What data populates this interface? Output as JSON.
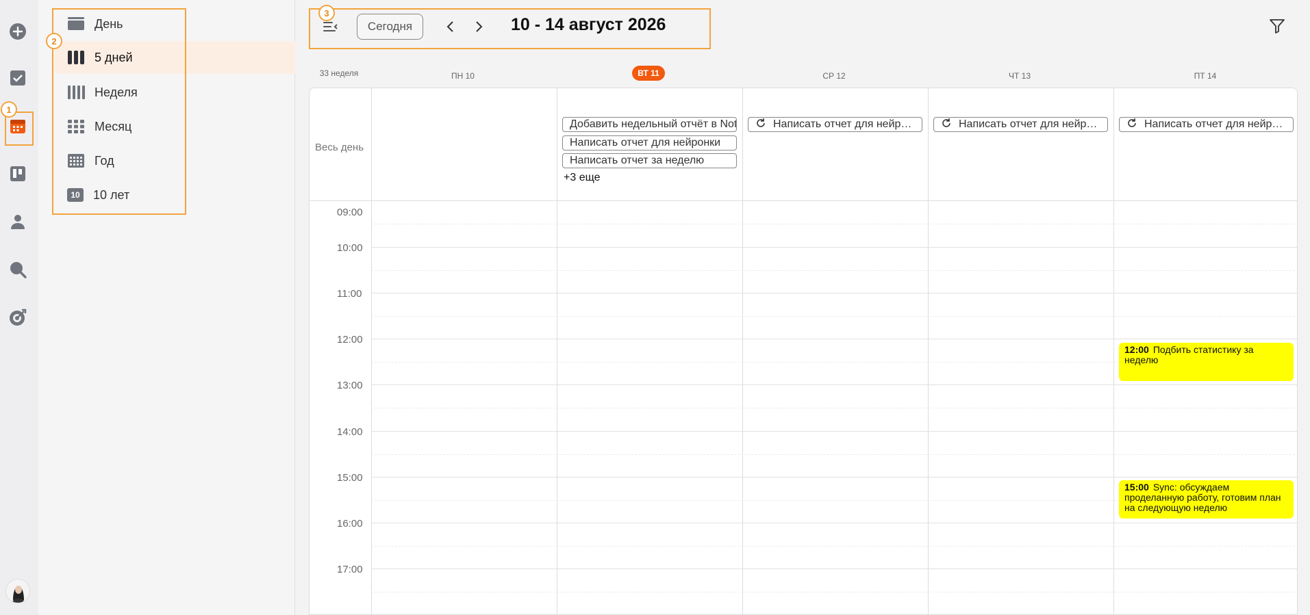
{
  "colors": {
    "accent": "#F25A0F",
    "annotation": "#F3A33C",
    "event_yellow": "#FFFF00"
  },
  "rail": {
    "items": [
      {
        "name": "plus-circle-icon"
      },
      {
        "name": "checkbox-icon"
      },
      {
        "name": "calendar-icon"
      },
      {
        "name": "kanban-icon"
      },
      {
        "name": "user-icon"
      },
      {
        "name": "search-icon"
      },
      {
        "name": "target-icon"
      }
    ],
    "badge": "1"
  },
  "views": {
    "badge": "2",
    "items": [
      {
        "label": "День",
        "icon": "day-view-icon"
      },
      {
        "label": "5 дней",
        "icon": "five-day-view-icon",
        "active": true
      },
      {
        "label": "Неделя",
        "icon": "week-view-icon"
      },
      {
        "label": "Месяц",
        "icon": "month-view-icon"
      },
      {
        "label": "Год",
        "icon": "year-view-icon"
      },
      {
        "label": "10 лет",
        "icon": "decade-view-icon",
        "icon_text": "10"
      }
    ]
  },
  "toolbar": {
    "badge": "3",
    "today_label": "Сегодня",
    "range_title": "10 - 14 август 2026"
  },
  "calendar": {
    "week_label": "33 неделя",
    "days": [
      {
        "label": "ПН 10"
      },
      {
        "label": "ВТ 11",
        "today": true
      },
      {
        "label": "СР 12"
      },
      {
        "label": "ЧТ 13"
      },
      {
        "label": "ПТ 14"
      }
    ],
    "allday_label": "Весь день",
    "allday_events": [
      {
        "day": 1,
        "row": 0,
        "title": "Добавить недельный отчёт в Notion"
      },
      {
        "day": 1,
        "row": 1,
        "title": "Написать отчет для нейронки"
      },
      {
        "day": 1,
        "row": 2,
        "title": "Написать отчет за неделю"
      },
      {
        "day": 2,
        "row": 0,
        "title": "Написать отчет для нейронки",
        "recurring": true
      },
      {
        "day": 3,
        "row": 0,
        "title": "Написать отчет для нейронки",
        "recurring": true
      },
      {
        "day": 4,
        "row": 0,
        "title": "Написать отчет для нейронки",
        "recurring": true
      }
    ],
    "more_label": "+3 еще",
    "hours": [
      "09:00",
      "10:00",
      "11:00",
      "12:00",
      "13:00",
      "14:00",
      "15:00",
      "16:00",
      "17:00"
    ],
    "events": [
      {
        "day": 4,
        "start": "12:00",
        "end": "12:50",
        "time": "12:00",
        "title": "Подбить статистику за неделю"
      },
      {
        "day": 4,
        "start": "15:00",
        "end": "15:50",
        "time": "15:00",
        "title": "Sync: обсуждаем проделанную работу, готовим план на следующую неделю"
      }
    ]
  }
}
